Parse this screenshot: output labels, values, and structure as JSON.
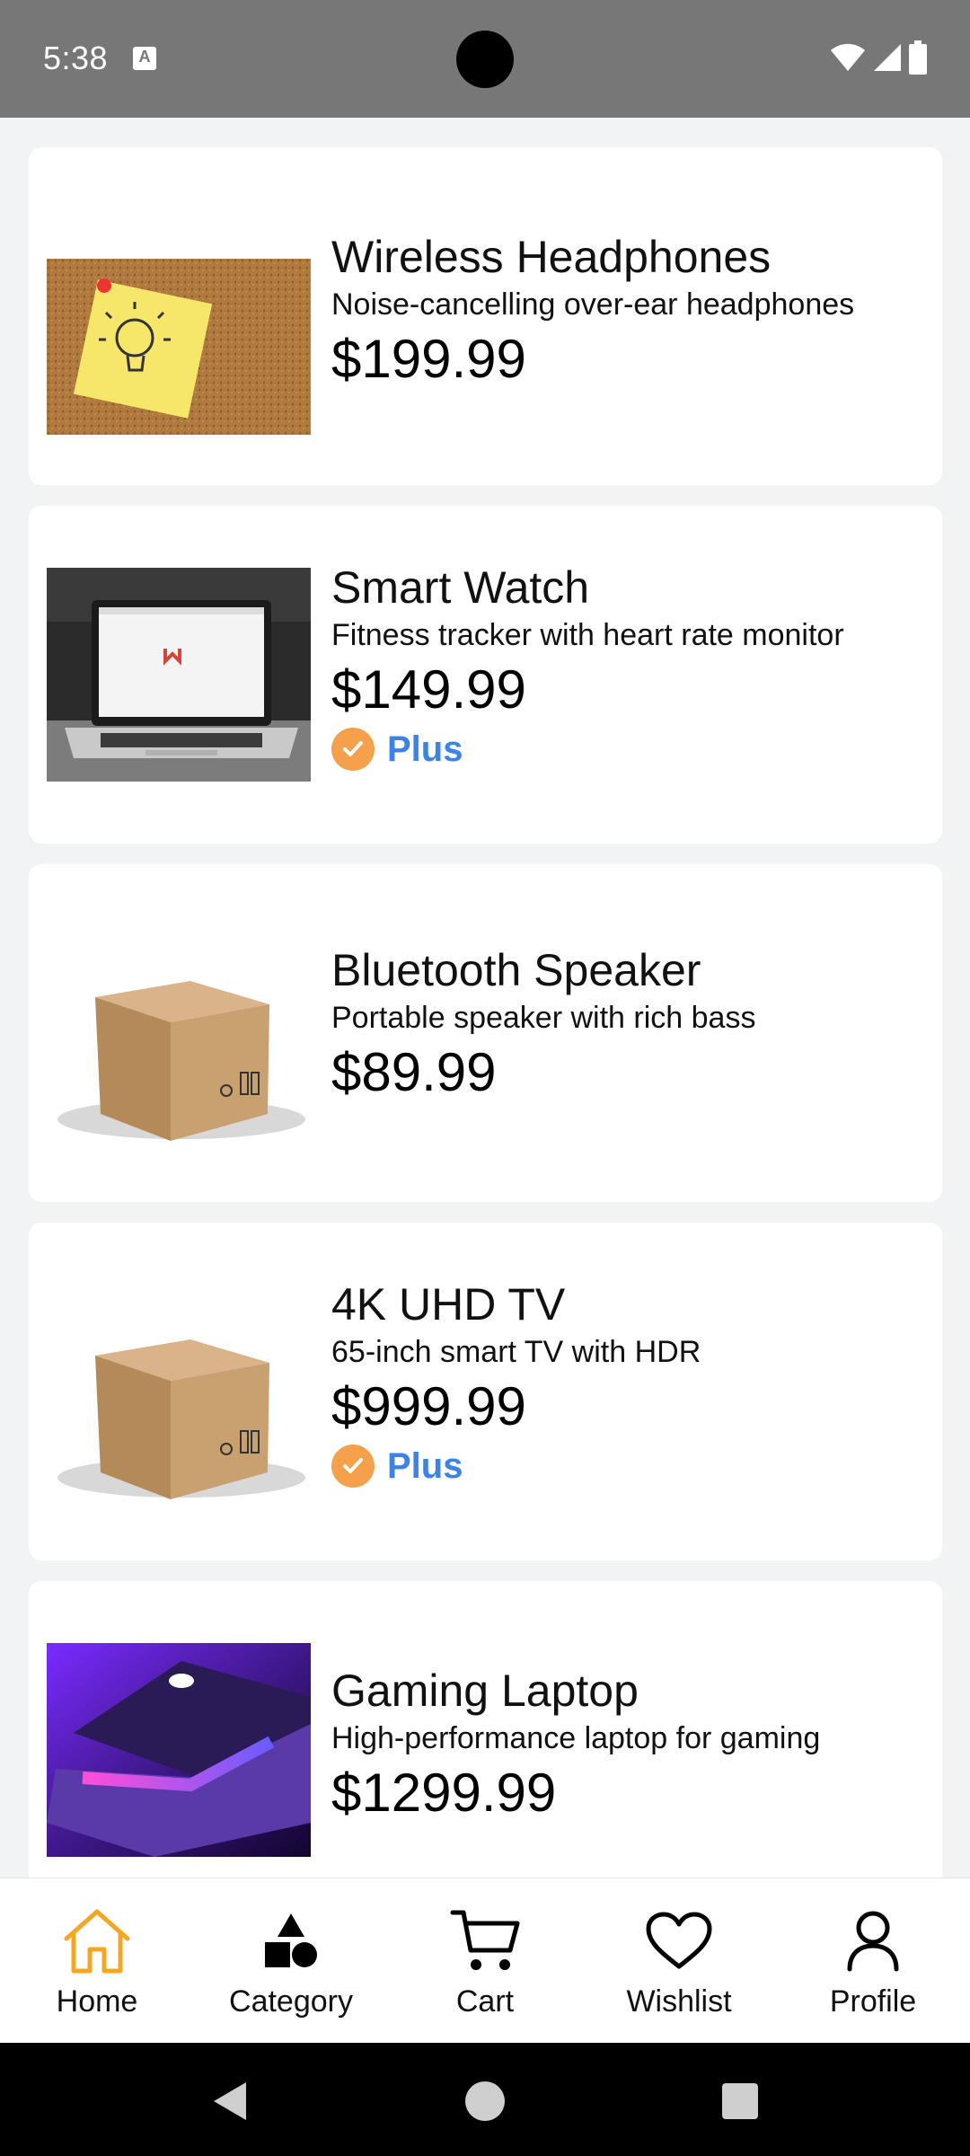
{
  "status_bar": {
    "time": "5:38",
    "icons": [
      "text-a-icon",
      "wifi-icon",
      "signal-icon",
      "battery-icon"
    ]
  },
  "products": [
    {
      "name": "Wireless Headphones",
      "description": "Noise-cancelling over-ear headphones",
      "price": "$199.99",
      "image": "sticky-note-lightbulb-image",
      "plus": false
    },
    {
      "name": "Smart Watch",
      "description": "Fitness tracker with heart rate monitor",
      "price": "$149.99",
      "image": "laptop-gmail-image",
      "plus": true,
      "plus_label": "Plus"
    },
    {
      "name": "Bluetooth Speaker",
      "description": "Portable speaker with rich bass",
      "price": "$89.99",
      "image": "cardboard-box-image",
      "plus": false
    },
    {
      "name": "4K UHD TV",
      "description": "65-inch smart TV with HDR",
      "price": "$999.99",
      "image": "cardboard-box-image",
      "plus": true,
      "plus_label": "Plus"
    },
    {
      "name": "Gaming Laptop",
      "description": "High-performance laptop for gaming",
      "price": "$1299.99",
      "image": "purple-laptop-image",
      "plus": false
    }
  ],
  "bottom_nav": {
    "active": "Home",
    "active_color": "#f5a623",
    "items": [
      {
        "label": "Home",
        "icon": "home-icon"
      },
      {
        "label": "Category",
        "icon": "shapes-icon"
      },
      {
        "label": "Cart",
        "icon": "cart-icon"
      },
      {
        "label": "Wishlist",
        "icon": "heart-icon"
      },
      {
        "label": "Profile",
        "icon": "person-icon"
      }
    ]
  },
  "colors": {
    "status_bar": "#777777",
    "background": "#f2f3f5",
    "plus_badge": "#f5a04a",
    "plus_text": "#3d82e6"
  }
}
